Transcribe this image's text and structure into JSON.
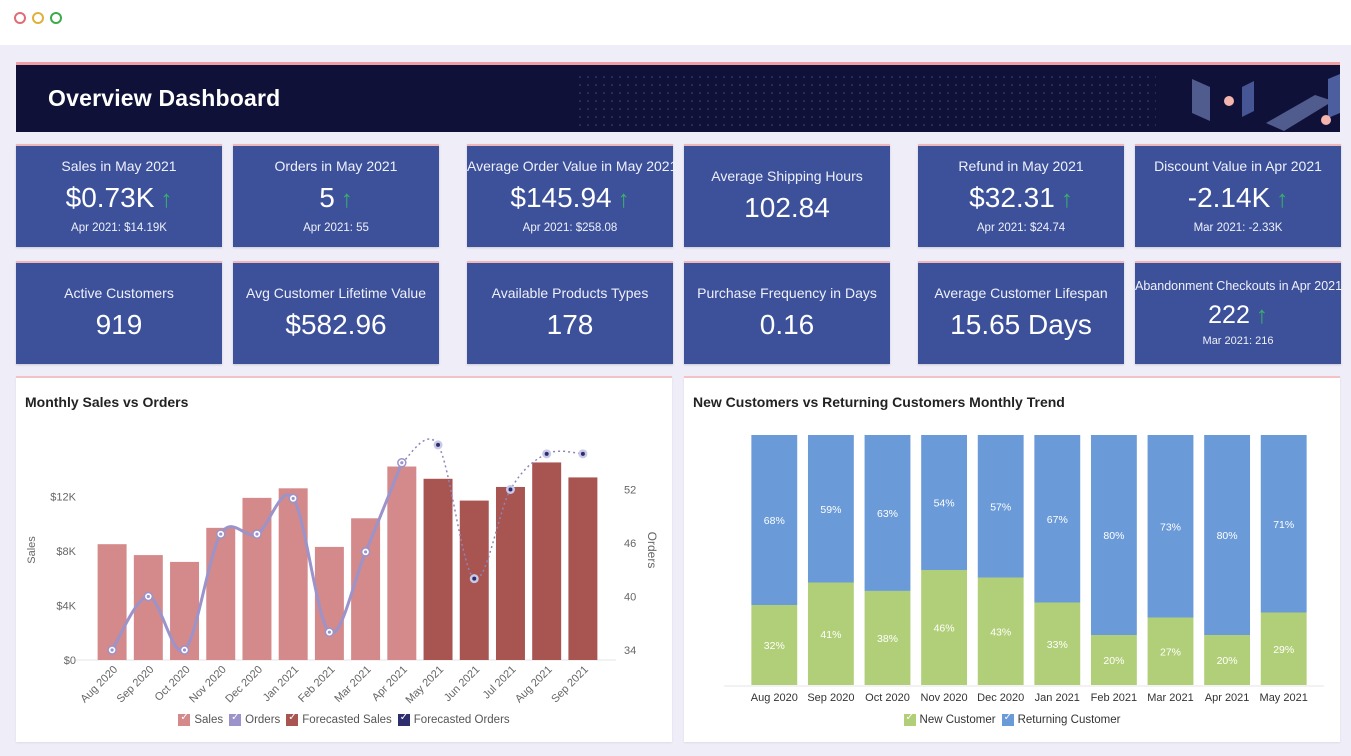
{
  "window": {
    "controls": [
      "close",
      "minimize",
      "maximize"
    ]
  },
  "header": {
    "title": "Overview Dashboard"
  },
  "colors": {
    "banner": "#0f1138",
    "kpi_card": "#3d519a",
    "up_arrow": "#39b06a",
    "sales": "#d4898a",
    "orders": "#9b93c9",
    "forecast_sales": "#a85450",
    "forecast_orders": "#2e2e6e",
    "new_customer": "#b1cf78",
    "returning_customer": "#6a9bd8"
  },
  "kpis_row1": [
    {
      "title": "Sales in May 2021",
      "value": "$0.73K",
      "trend": "up",
      "compare": "Apr 2021: $14.19K"
    },
    {
      "title": "Orders in May 2021",
      "value": "5",
      "trend": "up",
      "compare": "Apr 2021: 55"
    },
    {
      "title": "Average Order Value in May 2021",
      "value": "$145.94",
      "trend": "up",
      "compare": "Apr 2021: $258.08"
    },
    {
      "title": "Average Shipping Hours",
      "value": "102.84"
    },
    {
      "title": "Refund in May 2021",
      "value": "$32.31",
      "trend": "up",
      "compare": "Apr 2021: $24.74"
    },
    {
      "title": "Discount Value in Apr 2021",
      "value": "-2.14K",
      "trend": "up",
      "compare": "Mar 2021: -2.33K"
    }
  ],
  "kpis_row2": [
    {
      "title": "Active Customers",
      "value": "919"
    },
    {
      "title": "Avg Customer Lifetime Value",
      "value": "$582.96"
    },
    {
      "title": "Available Products Types",
      "value": "178"
    },
    {
      "title": "Purchase Frequency in Days",
      "value": "0.16"
    },
    {
      "title": "Average Customer Lifespan",
      "value": "15.65 Days"
    },
    {
      "title": "Abandonment Checkouts in Apr 2021",
      "value": "222",
      "trend": "up",
      "compare": "Mar 2021: 216"
    }
  ],
  "icons": {
    "trend_up": "↑"
  },
  "chart_data": [
    {
      "type": "bar",
      "title": "Monthly Sales vs Orders",
      "xlabel": "",
      "ylabel": "Sales",
      "y2label": "Orders",
      "ylim": [
        0,
        16
      ],
      "y_ticks": [
        "$0",
        "$4K",
        "$8K",
        "$12K"
      ],
      "y_tick_values": [
        0,
        4,
        8,
        12
      ],
      "y2lim": [
        34,
        58
      ],
      "y2_ticks": [
        "34",
        "40",
        "46",
        "52"
      ],
      "y2_tick_values": [
        34,
        40,
        46,
        52
      ],
      "categories": [
        "Aug 2020",
        "Sep 2020",
        "Oct 2020",
        "Nov 2020",
        "Dec 2020",
        "Jan 2021",
        "Feb 2021",
        "Mar 2021",
        "Apr 2021",
        "May 2021",
        "Jun 2021",
        "Jul 2021",
        "Aug 2021",
        "Sep 2021"
      ],
      "series": [
        {
          "name": "Sales",
          "kind": "bar",
          "unit": "K USD",
          "values": [
            8.5,
            7.7,
            7.2,
            9.7,
            11.9,
            12.6,
            8.3,
            10.4,
            14.2,
            null,
            null,
            null,
            null,
            null
          ]
        },
        {
          "name": "Forecasted Sales",
          "kind": "bar",
          "unit": "K USD",
          "values": [
            null,
            null,
            null,
            null,
            null,
            null,
            null,
            null,
            null,
            13.3,
            11.7,
            12.7,
            14.5,
            13.4
          ]
        },
        {
          "name": "Orders",
          "kind": "line",
          "axis": "right",
          "values": [
            34,
            40,
            34,
            47,
            47,
            51,
            36,
            45,
            55,
            null,
            null,
            null,
            null,
            null
          ]
        },
        {
          "name": "Forecasted Orders",
          "kind": "line-dashed",
          "axis": "right",
          "values": [
            null,
            null,
            null,
            null,
            null,
            null,
            null,
            null,
            55,
            57,
            42,
            52,
            56,
            56
          ]
        }
      ],
      "legend": [
        "Sales",
        "Orders",
        "Forecasted Sales",
        "Forecasted Orders"
      ],
      "legend_position": "bottom",
      "grid": false
    },
    {
      "type": "bar",
      "stacked": true,
      "percent": true,
      "title": "New Customers vs Returning Customers Monthly Trend",
      "xlabel": "",
      "ylabel": "",
      "ylim": [
        0,
        100
      ],
      "categories": [
        "Aug 2020",
        "Sep 2020",
        "Oct 2020",
        "Nov 2020",
        "Dec 2020",
        "Jan 2021",
        "Feb 2021",
        "Mar 2021",
        "Apr 2021",
        "May 2021"
      ],
      "series": [
        {
          "name": "New Customer",
          "values": [
            32,
            41,
            38,
            46,
            43,
            33,
            20,
            27,
            20,
            29
          ],
          "labels": [
            "32%",
            "41%",
            "38%",
            "46%",
            "43%",
            "33%",
            "20%",
            "27%",
            "20%",
            "29%"
          ]
        },
        {
          "name": "Returning Customer",
          "values": [
            68,
            59,
            63,
            54,
            57,
            67,
            80,
            73,
            80,
            71
          ],
          "labels": [
            "68%",
            "59%",
            "63%",
            "54%",
            "57%",
            "67%",
            "80%",
            "73%",
            "80%",
            "71%"
          ]
        }
      ],
      "legend": [
        "New Customer",
        "Returning Customer"
      ],
      "legend_position": "bottom",
      "grid": false
    }
  ]
}
